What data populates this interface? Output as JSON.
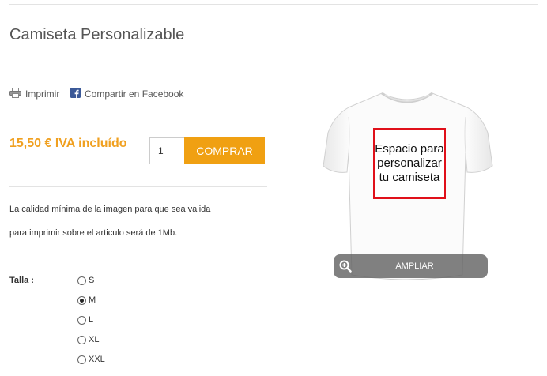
{
  "product": {
    "title": "Camiseta Personalizable",
    "price": "15,50 € IVA incluído",
    "quantity": "1",
    "buy_label": "COMPRAR"
  },
  "share": {
    "print_label": "Imprimir",
    "facebook_label": "Compartir en Facebook"
  },
  "description": {
    "line1": "La calidad mínima de la imagen  para que sea valida",
    "line2": "para imprimir sobre el articulo será de 1Mb."
  },
  "talla": {
    "label": "Talla :",
    "options": [
      "S",
      "M",
      "L",
      "XL",
      "XXL"
    ],
    "selected": "M"
  },
  "image": {
    "box_text": [
      "Espacio para",
      "personalizar",
      "tu camiseta"
    ],
    "box_color": "#e0101a",
    "ampliar_label": "AMPLIAR"
  },
  "colors": {
    "accent": "#f0a012",
    "facebook": "#3b5998"
  }
}
